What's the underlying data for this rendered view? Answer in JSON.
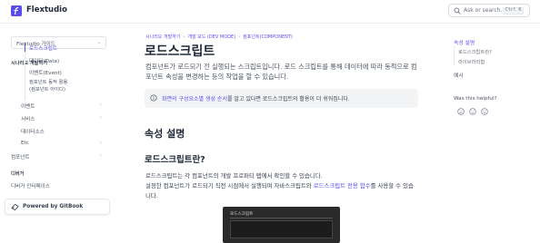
{
  "header": {
    "brand": "Flextudio",
    "search_placeholder": "Ask or search...",
    "search_shortcut": "Ctrl K",
    "brand_color": "#5b4ee8"
  },
  "sidebar": {
    "space_select": "Flextudio 가이드",
    "section1_title": "시나리오 개발하기",
    "items": [
      {
        "label": "로드스크립트",
        "active": true
      },
      {
        "label": "데이터(Data)"
      },
      {
        "label": "이벤트(Event)"
      },
      {
        "label": "컴포넌트 동적 활용"
      },
      {
        "label": "(컴포넌트 아이디)"
      }
    ],
    "groups": [
      "이벤트",
      "서비스",
      "데이터소스",
      "Etc",
      "컴포넌트"
    ],
    "section2_title": "디버거",
    "debugger_item": "디버거 인터페이스",
    "powered_by": "Powered by GitBook"
  },
  "main": {
    "breadcrumb": [
      "시나리오 개발하기",
      "개발 모드 (DEV MODE)",
      "컴포넌트(COMPONENT)"
    ],
    "title": "로드스크립트",
    "description": "컴포넌트가 로드되기 전 실행되는 스크립트입니다. 로드 스크립트를 통해 데이터에 따라 동적으로 컴포넌트 속성을 변경하는 등의 작업을 할 수 있습니다.",
    "hint_link": "화면의 구성요소별 생성 순서",
    "hint_rest": "를 알고 있다면 로드스크립트의 활용이 더 쉬워집니다.",
    "h2": "속성 설명",
    "h3": "로드스크립트란?",
    "para1": "로드스크립트는 각 컴포넌트의 개발 프로퍼티 탭에서 확인할 수 있습니다.",
    "para2_a": "설정한 컴포넌트가 로드되기 직전 시점에서 실행되며 자바스크립트와 ",
    "para2_link": "로드스크립트 전용 함수",
    "para2_b": "를 사용할 수 있습니다.",
    "screenshot_title": "로드스크립트"
  },
  "toc": {
    "items": [
      "속성 설명",
      "로드스크립트란?",
      "라이브러리함",
      "예시"
    ],
    "helpful": "Was this helpful?"
  }
}
